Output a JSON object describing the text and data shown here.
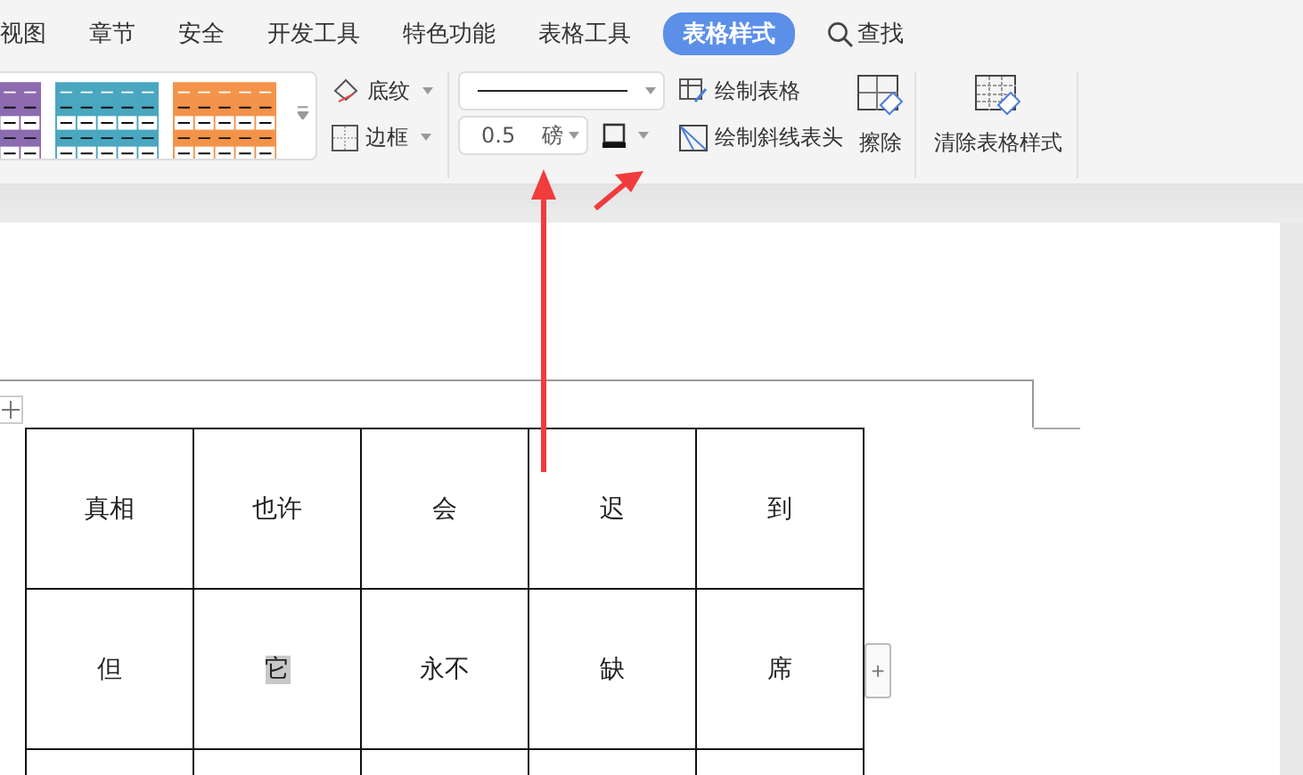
{
  "tabs": [
    {
      "label": "视图",
      "selected": false
    },
    {
      "label": "章节",
      "selected": false
    },
    {
      "label": "安全",
      "selected": false
    },
    {
      "label": "开发工具",
      "selected": false
    },
    {
      "label": "特色功能",
      "selected": false
    },
    {
      "label": "表格工具",
      "selected": false
    },
    {
      "label": "表格样式",
      "selected": true
    }
  ],
  "search": {
    "label": "查找"
  },
  "ribbon": {
    "style_gallery": [
      {
        "color": "#8e6bb0"
      },
      {
        "color": "#4aa7c0"
      },
      {
        "color": "#f4944a"
      }
    ],
    "shading_button": "底纹",
    "border_button": "边框",
    "line_width": {
      "value": "0.5",
      "unit": "磅"
    },
    "draw_table_button": "绘制表格",
    "draw_diagonal_header_button": "绘制斜线表头",
    "erase_button": "擦除",
    "clear_style_button": "清除表格样式"
  },
  "table": {
    "rows": [
      [
        {
          "text": "真相",
          "highlighted": false
        },
        {
          "text": "也许",
          "highlighted": false
        },
        {
          "text": "会",
          "highlighted": false
        },
        {
          "text": "迟",
          "highlighted": false
        },
        {
          "text": "到",
          "highlighted": false
        }
      ],
      [
        {
          "text": "但",
          "highlighted": false
        },
        {
          "text": "它",
          "highlighted": true
        },
        {
          "text": "永不",
          "highlighted": false
        },
        {
          "text": "缺",
          "highlighted": false
        },
        {
          "text": "席",
          "highlighted": false
        }
      ]
    ],
    "add_column_button": "+"
  }
}
